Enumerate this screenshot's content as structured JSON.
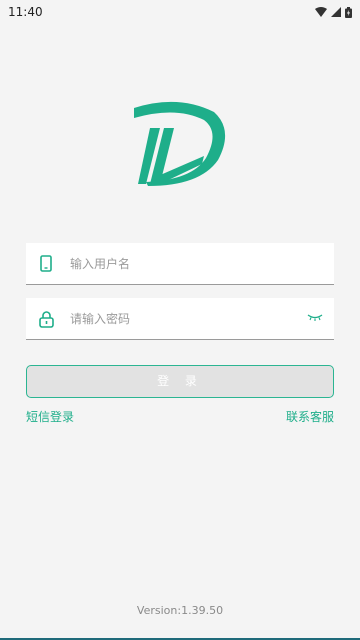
{
  "status_bar": {
    "time": "11:40"
  },
  "colors": {
    "brand": "#1eae8a",
    "button_bg": "#e2e2e2",
    "button_border": "#2bb592",
    "page_bg": "#f4f4f4"
  },
  "logo": {
    "icon": "d-letter-logo"
  },
  "form": {
    "username_placeholder": "输入用户名",
    "password_placeholder": "请输入密码",
    "username_icon": "phone-icon",
    "password_icon": "lock-icon",
    "toggle_icon": "eye-closed-icon",
    "login_label": "登 录"
  },
  "links": {
    "sms_login": "短信登录",
    "customer_service": "联系客服"
  },
  "footer": {
    "version": "Version:1.39.50"
  }
}
